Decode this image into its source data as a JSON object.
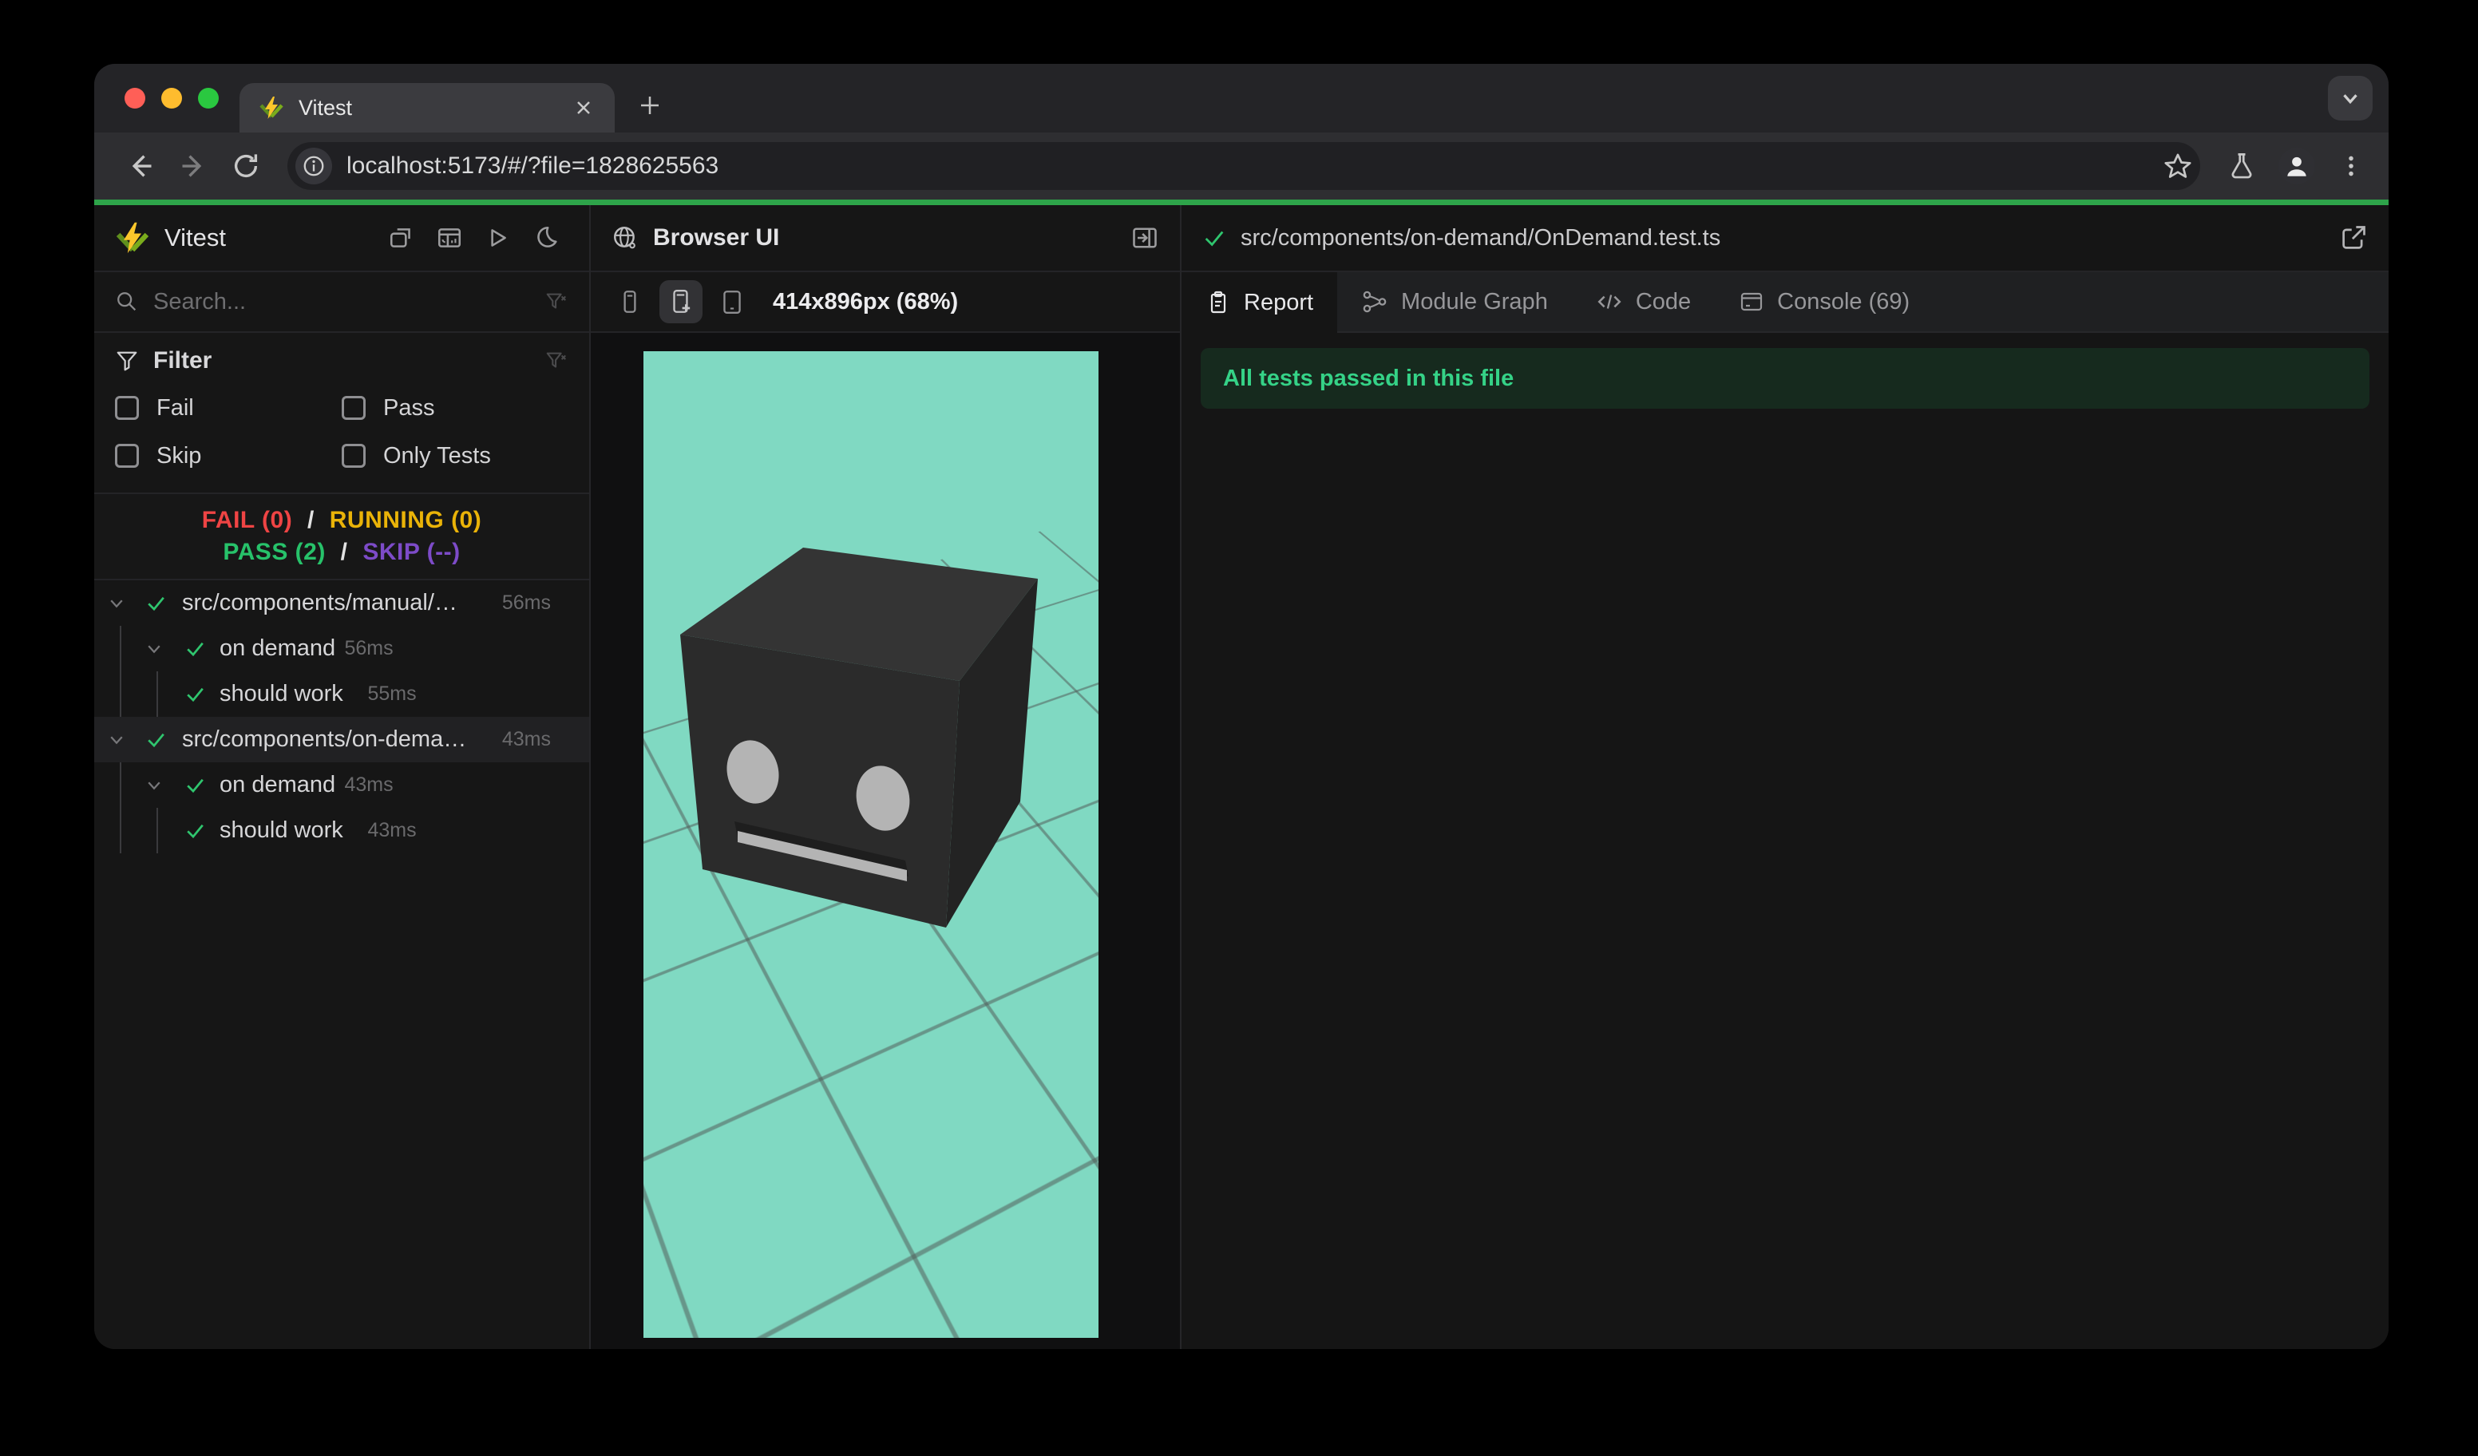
{
  "browser": {
    "tab_title": "Vitest",
    "url": "localhost:5173/#/?file=1828625563"
  },
  "sidebar": {
    "title": "Vitest",
    "search_placeholder": "Search...",
    "filter": {
      "label": "Filter",
      "options": [
        "Fail",
        "Pass",
        "Skip",
        "Only Tests"
      ]
    },
    "status": {
      "line1": [
        {
          "text": "FAIL (0)",
          "type": "fail"
        },
        {
          "text": "/",
          "type": "sep"
        },
        {
          "text": "RUNNING (0)",
          "type": "running"
        }
      ],
      "line2": [
        {
          "text": "PASS (2)",
          "type": "pass"
        },
        {
          "text": "/",
          "type": "sep"
        },
        {
          "text": "SKIP (--)",
          "type": "skip"
        }
      ]
    },
    "tree": [
      {
        "label": "src/components/manual/…",
        "time": "56ms",
        "depth": 0,
        "chevron": true,
        "time_right": true,
        "selected": false
      },
      {
        "label": "on demand",
        "time": "56ms",
        "depth": 1,
        "chevron": true,
        "time_right": false,
        "selected": false
      },
      {
        "label": "should work",
        "time": "55ms",
        "depth": 2,
        "chevron": false,
        "time_right": false,
        "selected": false
      },
      {
        "label": "src/components/on-dema…",
        "time": "43ms",
        "depth": 0,
        "chevron": true,
        "time_right": true,
        "selected": true
      },
      {
        "label": "on demand",
        "time": "43ms",
        "depth": 1,
        "chevron": true,
        "time_right": false,
        "selected": false
      },
      {
        "label": "should work",
        "time": "43ms",
        "depth": 2,
        "chevron": false,
        "time_right": false,
        "selected": false
      }
    ]
  },
  "preview": {
    "title": "Browser UI",
    "size_label": "414x896px (68%)"
  },
  "results": {
    "file_path": "src/components/on-demand/OnDemand.test.ts",
    "tabs": [
      {
        "label": "Report",
        "icon": "report",
        "active": true
      },
      {
        "label": "Module Graph",
        "icon": "graph",
        "active": false
      },
      {
        "label": "Code",
        "icon": "code",
        "active": false
      },
      {
        "label": "Console (69)",
        "icon": "console",
        "active": false
      }
    ],
    "banner": "All tests passed in this file"
  },
  "colors": {
    "progress_green": "#2ea44a",
    "pass_green": "#27c26a",
    "fail_red": "#ef4444",
    "running_yellow": "#eab308",
    "skip_purple": "#7d4bc8",
    "viewport_teal": "#80d9c2",
    "banner_green": "#35d287",
    "logo_yellow": "#fcc72b",
    "logo_green": "#729b1b"
  }
}
